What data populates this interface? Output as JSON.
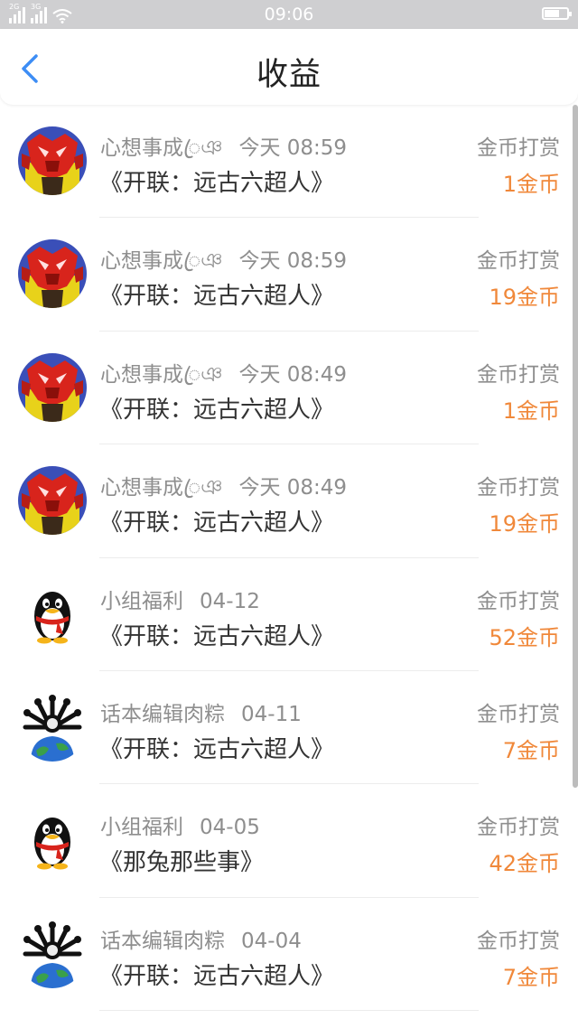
{
  "status_bar": {
    "time": "09:06",
    "net1": "2G",
    "net2": "3G"
  },
  "header": {
    "title": "收益"
  },
  "colors": {
    "accent": "#3d8df5",
    "amount": "#f0883a"
  },
  "items": [
    {
      "avatar": "red-mecha-avatar",
      "sender": "心想事成ꦿঞ",
      "time": "今天 08:59",
      "book": "《开联：远古六超人》",
      "type": "金币打赏",
      "amount": "1金币"
    },
    {
      "avatar": "red-mecha-avatar",
      "sender": "心想事成ꦿঞ",
      "time": "今天 08:59",
      "book": "《开联：远古六超人》",
      "type": "金币打赏",
      "amount": "19金币"
    },
    {
      "avatar": "red-mecha-avatar",
      "sender": "心想事成ꦿঞ",
      "time": "今天 08:49",
      "book": "《开联：远古六超人》",
      "type": "金币打赏",
      "amount": "1金币"
    },
    {
      "avatar": "red-mecha-avatar",
      "sender": "心想事成ꦿঞ",
      "time": "今天 08:49",
      "book": "《开联：远古六超人》",
      "type": "金币打赏",
      "amount": "19金币"
    },
    {
      "avatar": "penguin-avatar",
      "sender": "小组福利",
      "time": "04-12",
      "book": "《开联：远古六超人》",
      "type": "金币打赏",
      "amount": "52金币"
    },
    {
      "avatar": "earth-avatar",
      "sender": "话本编辑肉粽",
      "time": "04-11",
      "book": "《开联：远古六超人》",
      "type": "金币打赏",
      "amount": "7金币"
    },
    {
      "avatar": "penguin-avatar",
      "sender": "小组福利",
      "time": "04-05",
      "book": "《那兔那些事》",
      "type": "金币打赏",
      "amount": "42金币"
    },
    {
      "avatar": "earth-avatar",
      "sender": "话本编辑肉粽",
      "time": "04-04",
      "book": "《开联：远古六超人》",
      "type": "金币打赏",
      "amount": "7金币"
    }
  ]
}
